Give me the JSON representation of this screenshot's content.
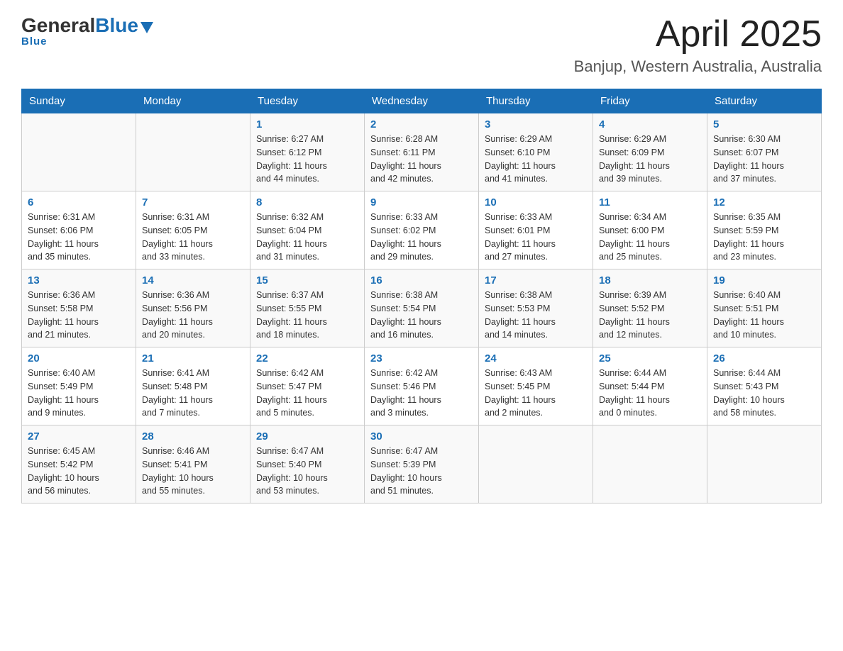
{
  "header": {
    "logo": {
      "general": "General",
      "blue": "Blue",
      "underline": "Blue"
    },
    "title": "April 2025",
    "location": "Banjup, Western Australia, Australia"
  },
  "calendar": {
    "days_of_week": [
      "Sunday",
      "Monday",
      "Tuesday",
      "Wednesday",
      "Thursday",
      "Friday",
      "Saturday"
    ],
    "weeks": [
      [
        {
          "day": "",
          "info": ""
        },
        {
          "day": "",
          "info": ""
        },
        {
          "day": "1",
          "info": "Sunrise: 6:27 AM\nSunset: 6:12 PM\nDaylight: 11 hours\nand 44 minutes."
        },
        {
          "day": "2",
          "info": "Sunrise: 6:28 AM\nSunset: 6:11 PM\nDaylight: 11 hours\nand 42 minutes."
        },
        {
          "day": "3",
          "info": "Sunrise: 6:29 AM\nSunset: 6:10 PM\nDaylight: 11 hours\nand 41 minutes."
        },
        {
          "day": "4",
          "info": "Sunrise: 6:29 AM\nSunset: 6:09 PM\nDaylight: 11 hours\nand 39 minutes."
        },
        {
          "day": "5",
          "info": "Sunrise: 6:30 AM\nSunset: 6:07 PM\nDaylight: 11 hours\nand 37 minutes."
        }
      ],
      [
        {
          "day": "6",
          "info": "Sunrise: 6:31 AM\nSunset: 6:06 PM\nDaylight: 11 hours\nand 35 minutes."
        },
        {
          "day": "7",
          "info": "Sunrise: 6:31 AM\nSunset: 6:05 PM\nDaylight: 11 hours\nand 33 minutes."
        },
        {
          "day": "8",
          "info": "Sunrise: 6:32 AM\nSunset: 6:04 PM\nDaylight: 11 hours\nand 31 minutes."
        },
        {
          "day": "9",
          "info": "Sunrise: 6:33 AM\nSunset: 6:02 PM\nDaylight: 11 hours\nand 29 minutes."
        },
        {
          "day": "10",
          "info": "Sunrise: 6:33 AM\nSunset: 6:01 PM\nDaylight: 11 hours\nand 27 minutes."
        },
        {
          "day": "11",
          "info": "Sunrise: 6:34 AM\nSunset: 6:00 PM\nDaylight: 11 hours\nand 25 minutes."
        },
        {
          "day": "12",
          "info": "Sunrise: 6:35 AM\nSunset: 5:59 PM\nDaylight: 11 hours\nand 23 minutes."
        }
      ],
      [
        {
          "day": "13",
          "info": "Sunrise: 6:36 AM\nSunset: 5:58 PM\nDaylight: 11 hours\nand 21 minutes."
        },
        {
          "day": "14",
          "info": "Sunrise: 6:36 AM\nSunset: 5:56 PM\nDaylight: 11 hours\nand 20 minutes."
        },
        {
          "day": "15",
          "info": "Sunrise: 6:37 AM\nSunset: 5:55 PM\nDaylight: 11 hours\nand 18 minutes."
        },
        {
          "day": "16",
          "info": "Sunrise: 6:38 AM\nSunset: 5:54 PM\nDaylight: 11 hours\nand 16 minutes."
        },
        {
          "day": "17",
          "info": "Sunrise: 6:38 AM\nSunset: 5:53 PM\nDaylight: 11 hours\nand 14 minutes."
        },
        {
          "day": "18",
          "info": "Sunrise: 6:39 AM\nSunset: 5:52 PM\nDaylight: 11 hours\nand 12 minutes."
        },
        {
          "day": "19",
          "info": "Sunrise: 6:40 AM\nSunset: 5:51 PM\nDaylight: 11 hours\nand 10 minutes."
        }
      ],
      [
        {
          "day": "20",
          "info": "Sunrise: 6:40 AM\nSunset: 5:49 PM\nDaylight: 11 hours\nand 9 minutes."
        },
        {
          "day": "21",
          "info": "Sunrise: 6:41 AM\nSunset: 5:48 PM\nDaylight: 11 hours\nand 7 minutes."
        },
        {
          "day": "22",
          "info": "Sunrise: 6:42 AM\nSunset: 5:47 PM\nDaylight: 11 hours\nand 5 minutes."
        },
        {
          "day": "23",
          "info": "Sunrise: 6:42 AM\nSunset: 5:46 PM\nDaylight: 11 hours\nand 3 minutes."
        },
        {
          "day": "24",
          "info": "Sunrise: 6:43 AM\nSunset: 5:45 PM\nDaylight: 11 hours\nand 2 minutes."
        },
        {
          "day": "25",
          "info": "Sunrise: 6:44 AM\nSunset: 5:44 PM\nDaylight: 11 hours\nand 0 minutes."
        },
        {
          "day": "26",
          "info": "Sunrise: 6:44 AM\nSunset: 5:43 PM\nDaylight: 10 hours\nand 58 minutes."
        }
      ],
      [
        {
          "day": "27",
          "info": "Sunrise: 6:45 AM\nSunset: 5:42 PM\nDaylight: 10 hours\nand 56 minutes."
        },
        {
          "day": "28",
          "info": "Sunrise: 6:46 AM\nSunset: 5:41 PM\nDaylight: 10 hours\nand 55 minutes."
        },
        {
          "day": "29",
          "info": "Sunrise: 6:47 AM\nSunset: 5:40 PM\nDaylight: 10 hours\nand 53 minutes."
        },
        {
          "day": "30",
          "info": "Sunrise: 6:47 AM\nSunset: 5:39 PM\nDaylight: 10 hours\nand 51 minutes."
        },
        {
          "day": "",
          "info": ""
        },
        {
          "day": "",
          "info": ""
        },
        {
          "day": "",
          "info": ""
        }
      ]
    ]
  }
}
